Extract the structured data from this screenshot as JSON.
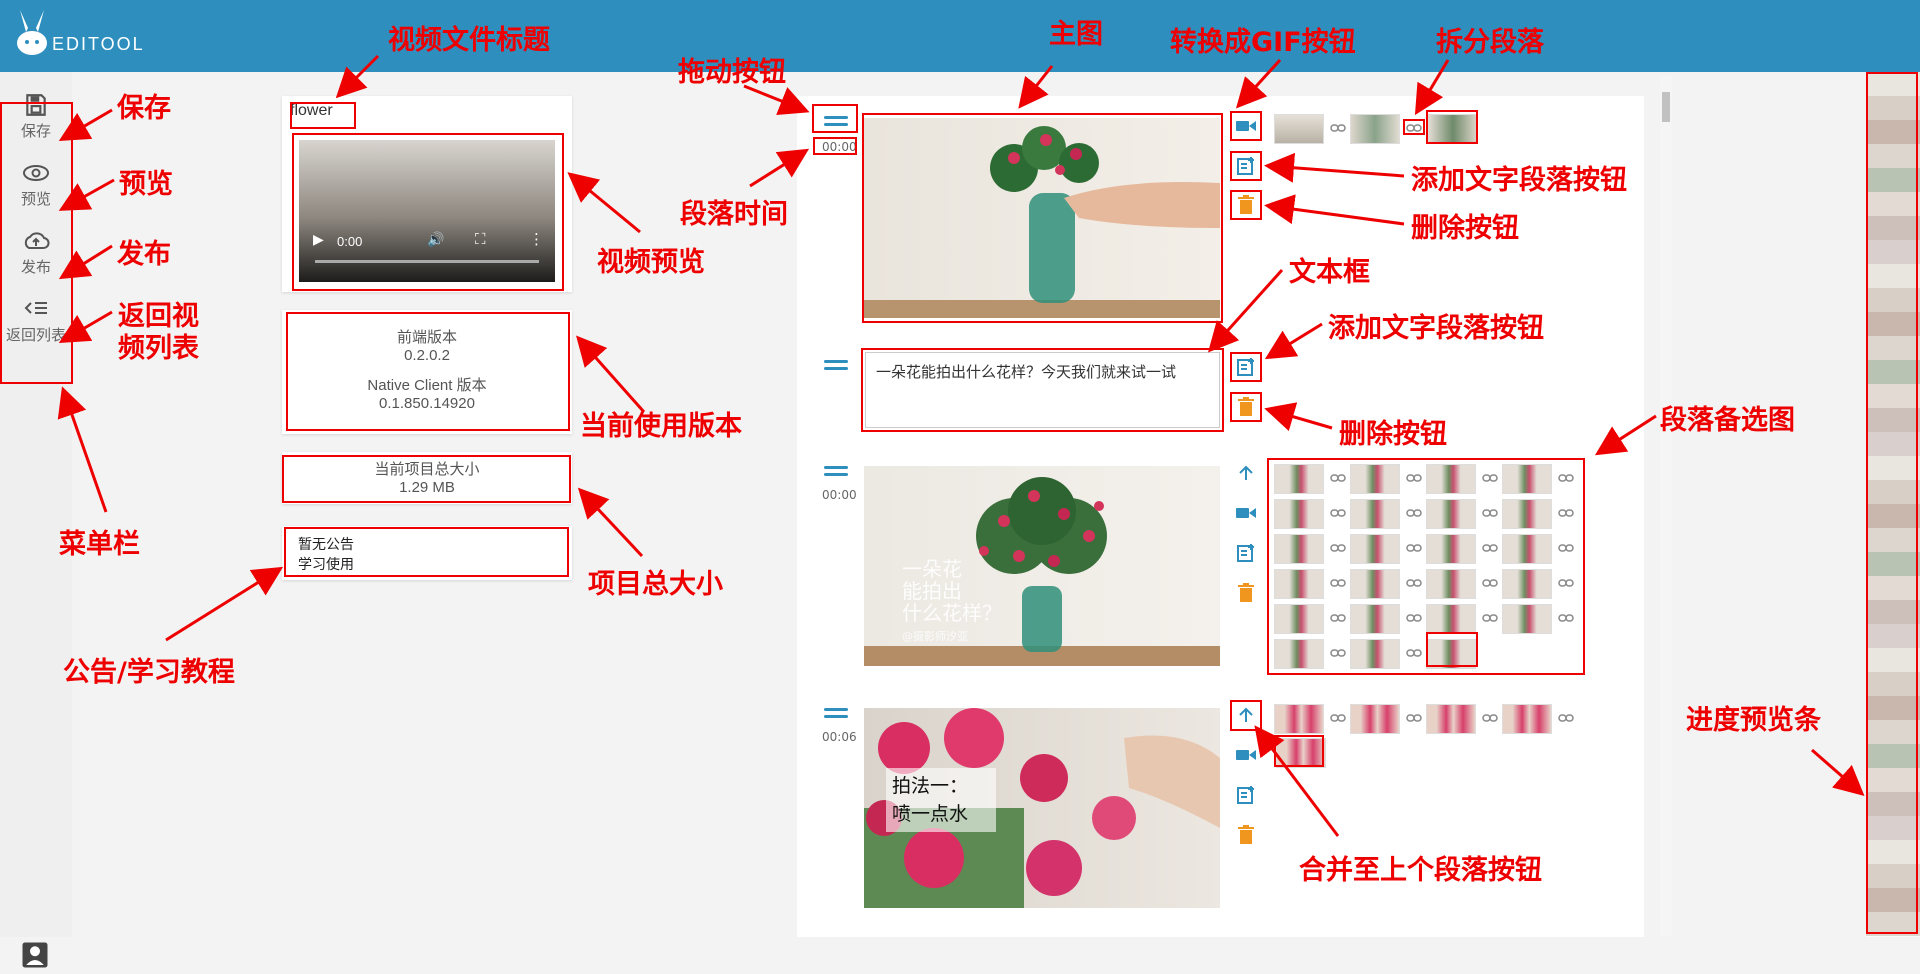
{
  "app": {
    "title": "EDITOOL"
  },
  "sidebar": {
    "items": [
      {
        "label": "保存",
        "icon": "save-icon"
      },
      {
        "label": "预览",
        "icon": "eye-icon"
      },
      {
        "label": "发布",
        "icon": "upload-icon"
      },
      {
        "label": "返回列表",
        "icon": "list-back-icon"
      }
    ]
  },
  "video": {
    "title": "flower",
    "time": "0:00"
  },
  "version": {
    "frontend_label": "前端版本",
    "frontend_value": "0.2.0.2",
    "client_label": "Native Client 版本",
    "client_value": "0.1.850.14920"
  },
  "project": {
    "size_label": "当前项目总大小",
    "size_value": "1.29 MB"
  },
  "notice": {
    "line1": "暂无公告",
    "line2": "学习使用"
  },
  "segments": [
    {
      "time": "00:00"
    },
    {
      "text": "一朵花能拍出什么花样？今天我们就来试一试"
    },
    {
      "time": "00:00",
      "overlay": [
        "一朵花",
        "能拍出",
        "什么花样？",
        "@摄影师汐亚"
      ]
    },
    {
      "time": "00:06",
      "overlay": [
        "拍法一：",
        "喷一点水"
      ]
    }
  ],
  "annotations": {
    "video_title": "视频文件标题",
    "main_image": "主图",
    "gif_button": "转换成GIF按钮",
    "split": "拆分段落",
    "save": "保存",
    "drag": "拖动按钮",
    "preview": "预览",
    "publish": "发布",
    "back1": "返回视",
    "back2": "频列表",
    "seg_time": "段落时间",
    "video_preview": "视频预览",
    "add_text": "添加文字段落按钮",
    "delete": "删除按钮",
    "textbox": "文本框",
    "add_text2": "添加文字段落按钮",
    "version": "当前使用版本",
    "delete2": "删除按钮",
    "candidates": "段落备选图",
    "menubar": "菜单栏",
    "project_size": "项目总大小",
    "notice": "公告/学习教程",
    "progress": "进度预览条",
    "merge": "合并至上个段落按钮"
  },
  "colors": {
    "header": "#2e8fbf",
    "accent": "#2e8fbf",
    "delete": "#f0961e",
    "annotation": "#ee0000"
  }
}
